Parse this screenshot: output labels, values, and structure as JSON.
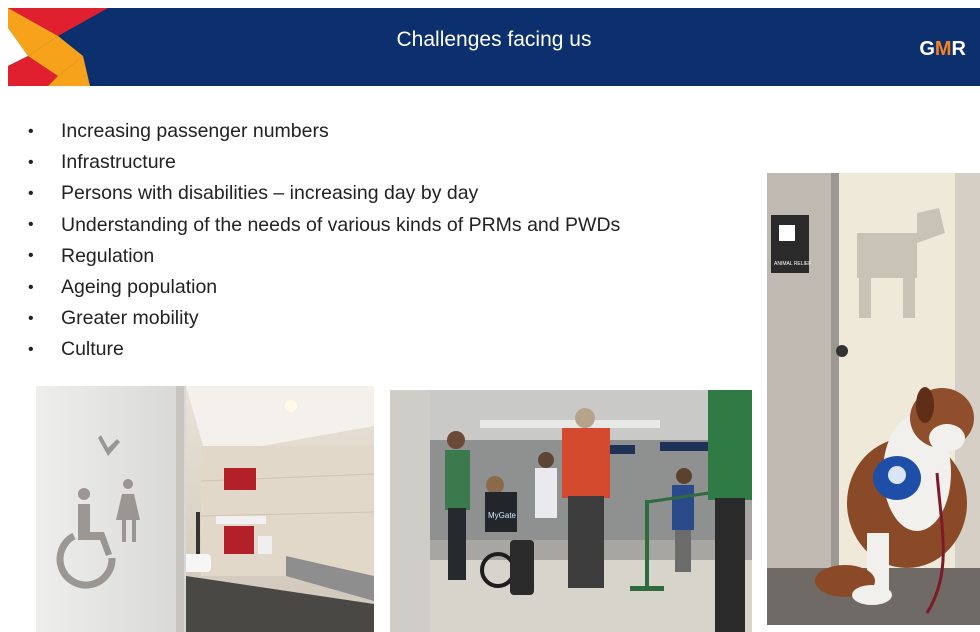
{
  "header": {
    "title": "Challenges facing us",
    "brand_logo_text": "GMR",
    "colors": {
      "bar": "#0c2f6e",
      "accent_red": "#e0202e",
      "accent_orange": "#f7a21b"
    }
  },
  "bullets": [
    "Increasing passenger numbers",
    "Infrastructure",
    "Persons with disabilities – increasing day by day",
    "Understanding of the needs of various kinds of PRMs and PWDs",
    "Regulation",
    "Ageing population",
    "Greater mobility",
    "Culture"
  ],
  "bullet_symbol": "•",
  "photos": {
    "bathroom": {
      "subject": "accessible restroom with wheelchair and family-room signage"
    },
    "queue": {
      "subject": "passengers including a wheelchair user queuing at airport security",
      "sign_text": "MyGate"
    },
    "dog": {
      "subject": "St. Bernard service dog sitting beside animal relief area door",
      "sign_text": "ANIMAL RELIEF"
    }
  }
}
